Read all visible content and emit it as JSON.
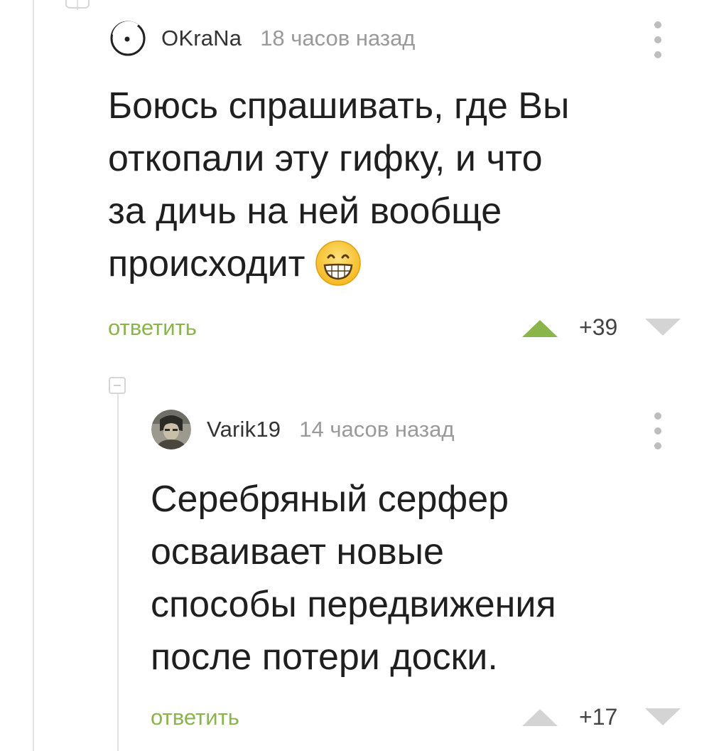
{
  "comments": [
    {
      "username": "OKraNa",
      "time": "18 часов назад",
      "text_lines": [
        "Боюсь спрашивать, где Вы",
        "откопали эту гифку, и что",
        "за дичь на ней вообще",
        "происходит"
      ],
      "emoji": "grinning-face-emoji",
      "reply_label": "ответить",
      "rating": "+39",
      "upvoted": true,
      "accent_color": "#8ab54b"
    },
    {
      "username": "Varik19",
      "time": "14 часов назад",
      "text_lines": [
        "Серебряный серфер",
        "осваивает новые",
        "способы передвижения",
        "после потери доски."
      ],
      "reply_label": "ответить",
      "rating": "+17",
      "upvoted": false,
      "accent_color": "#8ab54b"
    }
  ],
  "icons": {
    "more": "more-vertical-icon",
    "upvote": "upvote-triangle-icon",
    "downvote": "downvote-triangle-icon",
    "collapse": "collapse-thread-icon"
  }
}
